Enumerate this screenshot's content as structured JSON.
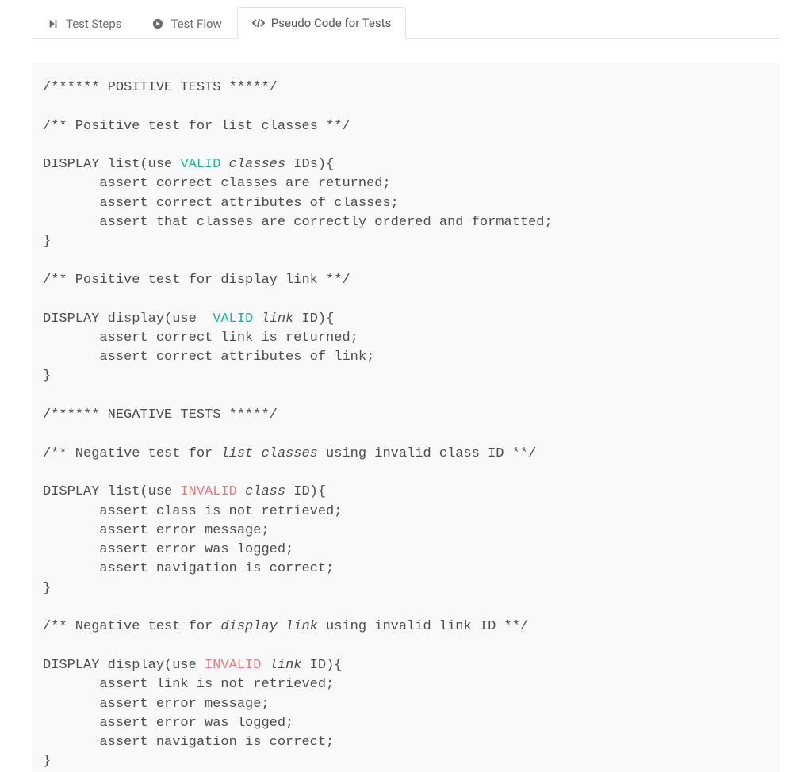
{
  "tabs": {
    "test_steps": "Test Steps",
    "test_flow": "Test Flow",
    "pseudo_code": "Pseudo Code for Tests"
  },
  "code": {
    "l01": "/****** POSITIVE TESTS *****/",
    "l02": "/** Positive test for list classes **/",
    "l03a": "DISPLAY list(use ",
    "l03b": "VALID",
    "l03c": " ",
    "l03d": "classes",
    "l03e": " IDs){",
    "l04": "       assert correct classes are returned;",
    "l05": "       assert correct attributes of classes;",
    "l06": "       assert that classes are correctly ordered and formatted;",
    "l07": "}",
    "l08": "/** Positive test for display link **/",
    "l09a": "DISPLAY display(use  ",
    "l09b": "VALID",
    "l09c": " ",
    "l09d": "link",
    "l09e": " ID){",
    "l10": "       assert correct link is returned;",
    "l11": "       assert correct attributes of link;",
    "l12": "}",
    "l13": "/****** NEGATIVE TESTS *****/",
    "l14a": "/** Negative test for ",
    "l14b": "list classes",
    "l14c": " using invalid class ID **/",
    "l15a": "DISPLAY list(use ",
    "l15b": "INVALID",
    "l15c": " ",
    "l15d": "class",
    "l15e": " ID){",
    "l16": "       assert class is not retrieved;",
    "l17": "       assert error message;",
    "l18": "       assert error was logged;",
    "l19": "       assert navigation is correct;",
    "l20": "}",
    "l21a": "/** Negative test for ",
    "l21b": "display link",
    "l21c": " using invalid link ID **/",
    "l22a": "DISPLAY display(use ",
    "l22b": "INVALID",
    "l22c": " ",
    "l22d": "link",
    "l22e": " ID){",
    "l23": "       assert link is not retrieved;",
    "l24": "       assert error message;",
    "l25": "       assert error was logged;",
    "l26": "       assert navigation is correct;",
    "l27": "}"
  }
}
